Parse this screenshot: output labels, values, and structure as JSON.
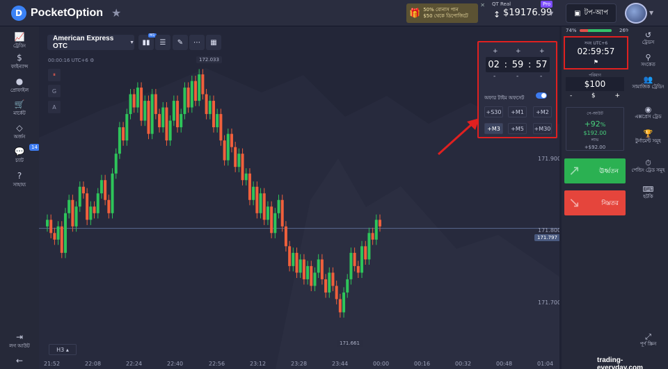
{
  "brand": {
    "logo_text": "PocketOption"
  },
  "header": {
    "bonus_line1": "50% বোনাস পান",
    "bonus_line2": "$50 থেকে ডিপোজিটে",
    "account_label": "QT Real",
    "balance": "$19176.99",
    "pro_badge": "Pro",
    "topup_label": "টপ-আপ"
  },
  "left_nav": [
    {
      "label": "ট্রেডিং",
      "icon": "chart-icon"
    },
    {
      "label": "ফাইন্যান্স",
      "icon": "dollar-icon"
    },
    {
      "label": "প্রোফাইল",
      "icon": "user-icon"
    },
    {
      "label": "মার্কেট",
      "icon": "cart-icon"
    },
    {
      "label": "অর্জন",
      "icon": "diamond-icon"
    },
    {
      "label": "চ্যাট",
      "icon": "chat-icon",
      "badge": "14"
    },
    {
      "label": "সাহায্য",
      "icon": "help-icon"
    },
    {
      "label": "লগ আউট",
      "icon": "logout-icon"
    }
  ],
  "chart_toolbar": {
    "asset": "American Express OTC",
    "timeframe_badge": "M1",
    "clock": "00:00:16 UTC+6",
    "tool_letters": [
      "G",
      "A"
    ],
    "interval": "H3"
  },
  "popup": {
    "hours": "02",
    "minutes": "59",
    "seconds": "57",
    "plus": "+",
    "minus": "-",
    "colon": ":",
    "offset_label": "অফার টাইম অফসেট",
    "presets": [
      "+S30",
      "+M1",
      "+M2",
      "+M3",
      "+M5",
      "+M30"
    ],
    "selected_preset": "+M3"
  },
  "trade_panel": {
    "sentiment_left": "74%",
    "sentiment_right": "26%",
    "sentiment_up_fraction": 0.74,
    "time_label": "সময় UTC+6",
    "time_value": "02:59:57",
    "amount_label": "পরিমাণ",
    "amount_value": "$100",
    "amount_minus": "-",
    "amount_currency": "$",
    "amount_plus": "+",
    "payout_label": "পে-আউট",
    "payout_percent": "+92",
    "payout_percent_sign": "%",
    "payout_profit": "$192.00",
    "payout_profit_label": "লাভ",
    "payout_gain": "+$92.00",
    "up_label": "ঊর্ধ্বতন",
    "down_label": "নিম্নতর"
  },
  "right_nav": [
    {
      "label": "ট্রেডস",
      "icon": "history-icon"
    },
    {
      "label": "সংকেত",
      "icon": "signal-icon"
    },
    {
      "label": "সামাজিক ট্রেডিং",
      "icon": "social-icon"
    },
    {
      "label": "এক্সপ্রেস ট্রেড",
      "icon": "express-icon"
    },
    {
      "label": "টুর্নামেন্ট সমূহ",
      "icon": "trophy-icon"
    },
    {
      "label": "পেন্ডিং ট্রেড সমূহ",
      "icon": "pending-icon"
    },
    {
      "label": "হটকি",
      "icon": "keyboard-icon"
    },
    {
      "label": "পূর্ণ স্ক্রিন",
      "icon": "fullscreen-icon"
    }
  ],
  "chart_data": {
    "type": "candlestick",
    "price_ticks": [
      "171.900",
      "171.800",
      "171.700"
    ],
    "current_price": "171.797",
    "high_label": "172.033",
    "low_label": "171.661",
    "time_ticks": [
      "21:52",
      "22:08",
      "22:24",
      "22:40",
      "22:56",
      "23:12",
      "23:28",
      "23:44",
      "00:00",
      "00:16",
      "00:32",
      "00:48",
      "01:04"
    ],
    "ylim": [
      171.64,
      172.05
    ],
    "closes": [
      171.81,
      171.79,
      171.78,
      171.8,
      171.76,
      171.82,
      171.84,
      171.8,
      171.83,
      171.86,
      171.85,
      171.81,
      171.83,
      171.82,
      171.85,
      171.87,
      171.84,
      171.82,
      171.88,
      171.91,
      171.95,
      171.93,
      171.97,
      172.0,
      171.98,
      172.01,
      171.96,
      171.99,
      171.94,
      172.0,
      171.97,
      171.95,
      171.98,
      171.93,
      171.96,
      171.99,
      171.95,
      171.97,
      172.01,
      171.98,
      172.02,
      171.99,
      172.03,
      172.0,
      171.97,
      171.99,
      171.95,
      171.97,
      171.93,
      171.9,
      171.94,
      171.92,
      171.89,
      171.91,
      171.87,
      171.88,
      171.84,
      171.86,
      171.82,
      171.85,
      171.81,
      171.83,
      171.79,
      171.82,
      171.84,
      171.8,
      171.77,
      171.74,
      171.76,
      171.73,
      171.75,
      171.72,
      171.74,
      171.71,
      171.73,
      171.75,
      171.72,
      171.7,
      171.73,
      171.71,
      171.69,
      171.67,
      171.7,
      171.72,
      171.76,
      171.74,
      171.73,
      171.77,
      171.75,
      171.79,
      171.78,
      171.81,
      171.8
    ]
  },
  "watermark": "trading-everyday.com"
}
